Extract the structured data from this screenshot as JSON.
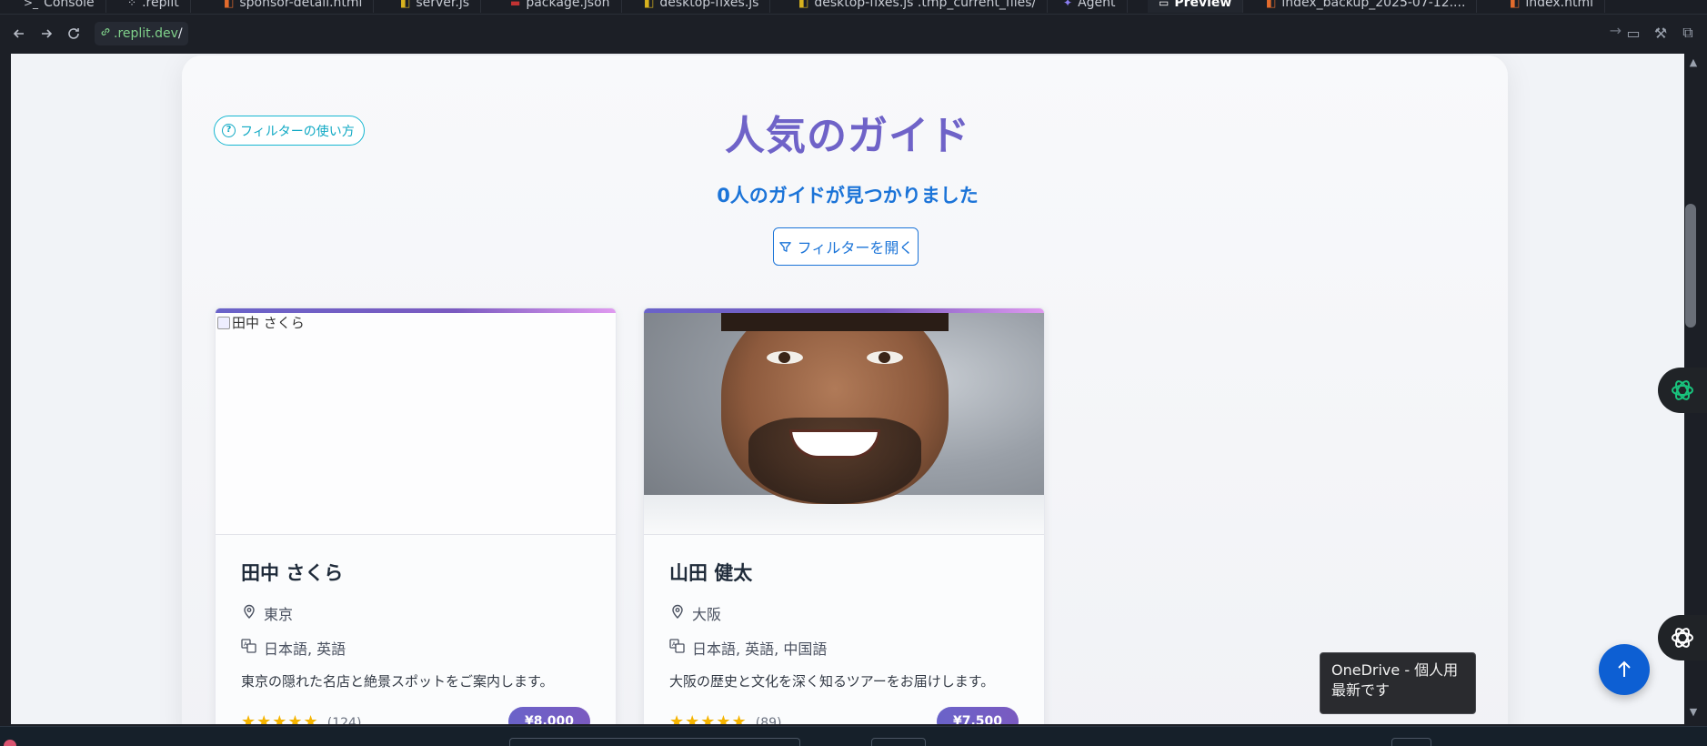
{
  "tabs": [
    {
      "label": "Console",
      "icon": "terminal-icon",
      "active": false
    },
    {
      "label": ".replit",
      "icon": "config-icon",
      "active": false
    },
    {
      "label": "sponsor-detail.html",
      "icon": "html-file-icon",
      "active": false
    },
    {
      "label": "server.js",
      "icon": "js-file-icon",
      "active": false
    },
    {
      "label": "package.json",
      "icon": "npm-icon",
      "active": false
    },
    {
      "label": "desktop-fixes.js",
      "icon": "js-file-icon",
      "active": false
    },
    {
      "label": "desktop-fixes.js .tmp_current_files/",
      "icon": "js-file-icon",
      "active": false
    },
    {
      "label": "Agent",
      "icon": "agent-icon",
      "active": false
    },
    {
      "label": "Preview",
      "icon": "monitor-icon",
      "active": true
    },
    {
      "label": "index_backup_2025-07-12....",
      "icon": "html-file-icon",
      "active": false
    },
    {
      "label": "index.html",
      "icon": "html-file-icon",
      "active": false
    }
  ],
  "address": {
    "host": ".replit.dev",
    "path": "/"
  },
  "page": {
    "help_label": "フィルターの使い方",
    "title": "人気のガイド",
    "result_count": "0人のガイドが見つかりました",
    "filter_button": "フィルターを開く"
  },
  "guides": [
    {
      "image_alt": "田中 さくら",
      "image_loaded": false,
      "name": "田中 さくら",
      "location": "東京",
      "languages": "日本語, 英語",
      "description": "東京の隠れた名店と絶景スポットをご案内します。",
      "stars": "★★★★★",
      "reviews": "(124)",
      "price": "¥8,000"
    },
    {
      "image_alt": "山田 健太",
      "image_loaded": true,
      "name": "山田 健太",
      "location": "大阪",
      "languages": "日本語, 英語, 中国語",
      "description": "大阪の歴史と文化を深く知るツアーをお届けします。",
      "stars": "★★★★★",
      "reviews": "(89)",
      "price": "¥7,500"
    }
  ],
  "toast": {
    "line1": "OneDrive - 個人用",
    "line2": "最新です"
  },
  "colors": {
    "title": "#6f63c8",
    "accent_blue": "#1b74d8",
    "help_cyan": "#10a9c4",
    "price_gradient_start": "#6a63c9",
    "star": "#f5b400",
    "fab": "#0d5fd3"
  }
}
